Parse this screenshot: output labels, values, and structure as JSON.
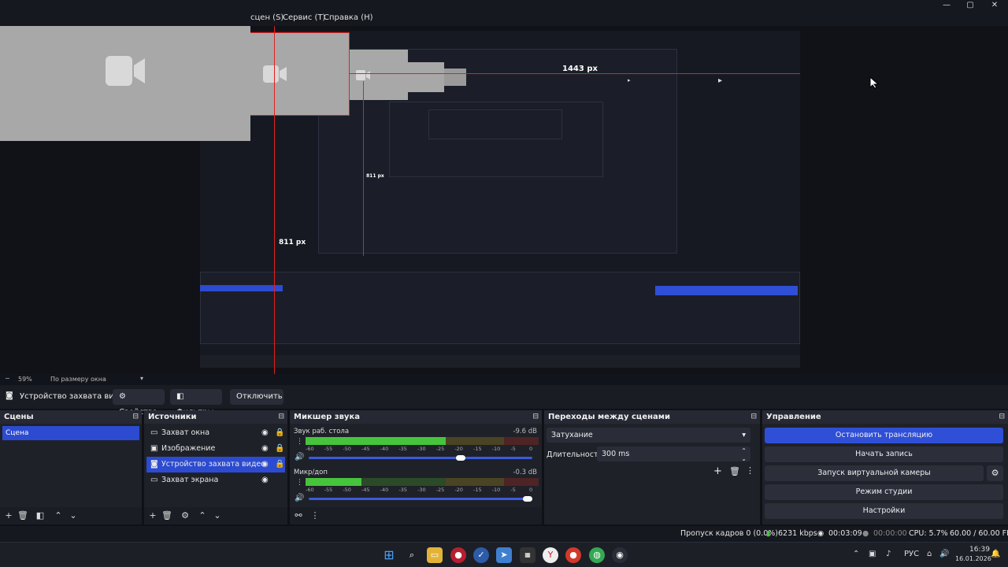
{
  "window": {
    "minimize_glyph": "—",
    "maximize_glyph": "▢",
    "close_glyph": "✕"
  },
  "menu": {
    "items": [
      "сцен (S)",
      "Сервис (T)",
      "Справка (H)"
    ]
  },
  "preview": {
    "measure_top": "1443 px",
    "measure_mid": "811 px",
    "measure_left": "811 px",
    "ghost_color": "#a8a8a8",
    "guide_color": "#e02020"
  },
  "zoom": {
    "minus": "−",
    "value": "59%",
    "mode": "По размеру окна"
  },
  "source_toolbar": {
    "source_name": "Устройство захвата видео",
    "properties": "Свойства",
    "filters": "Фильтры",
    "disable": "Отключить"
  },
  "scenes": {
    "title": "Сцены",
    "items": [
      "Сцена"
    ]
  },
  "sources": {
    "title": "Источники",
    "items": [
      {
        "label": "Захват окна",
        "icon": "window-icon",
        "selected": false
      },
      {
        "label": "Изображение",
        "icon": "image-icon",
        "selected": false
      },
      {
        "label": "Устройство захвата видео",
        "icon": "camera-icon",
        "selected": true
      },
      {
        "label": "Захват экрана",
        "icon": "monitor-icon",
        "selected": false
      }
    ]
  },
  "mixer": {
    "title": "Микшер звука",
    "scale": [
      "-60",
      "-55",
      "-50",
      "-45",
      "-40",
      "-35",
      "-30",
      "-25",
      "-20",
      "-15",
      "-10",
      "-5",
      "0"
    ],
    "channels": [
      {
        "name": "Звук раб. стола",
        "db": "-9.6 dB",
        "level": 0.6,
        "volume": 0.7
      },
      {
        "name": "Микр/доп",
        "db": "-0.3 dB",
        "level": 0.24,
        "volume": 1.0
      }
    ]
  },
  "transitions": {
    "title": "Переходы между сценами",
    "selected": "Затухание",
    "duration_label": "Длительность",
    "duration_value": "300 ms"
  },
  "controls": {
    "title": "Управление",
    "stop_stream": "Остановить трансляцию",
    "start_record": "Начать запись",
    "virtual_cam": "Запуск виртуальной камеры",
    "studio_mode": "Режим студии",
    "settings": "Настройки",
    "accent_color": "#2f4fd6"
  },
  "status": {
    "dropped": "Пропуск кадров 0 (0.0%)",
    "bitrate": "6231 kbps",
    "stream_time": "00:03:09",
    "rec_time": "00:00:00",
    "cpu": "CPU: 5.7%",
    "fps": "60.00 / 60.00 FPS"
  },
  "taskbar": {
    "lang": "РУС",
    "time": "16:39",
    "date": "16.01.2026"
  }
}
